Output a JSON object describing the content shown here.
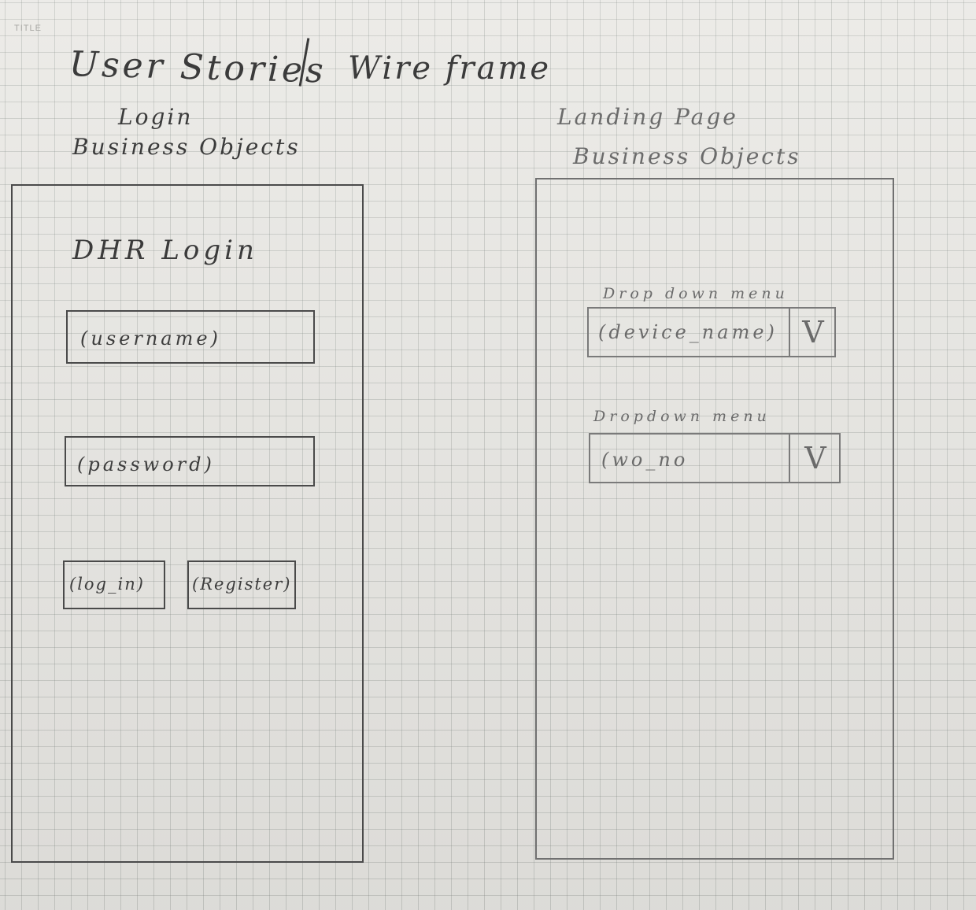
{
  "sheet": {
    "corner_label": "TITLE",
    "title_left": "User Stories",
    "title_right": "Wire frame"
  },
  "login_screen": {
    "heading": "Login",
    "subheading": "Business Objects",
    "app_title": "DHR Login",
    "username_placeholder": "(username)",
    "password_placeholder": "(password)",
    "login_button": "(log_in)",
    "register_button": "(Register)"
  },
  "landing_screen": {
    "heading": "Landing Page",
    "subheading": "Business Objects",
    "dropdown_1": {
      "caption": "Drop down menu",
      "value": "(device_name)",
      "toggle": "V"
    },
    "dropdown_2": {
      "caption": "Dropdown menu",
      "value": "(wo_no",
      "toggle": "V"
    }
  }
}
